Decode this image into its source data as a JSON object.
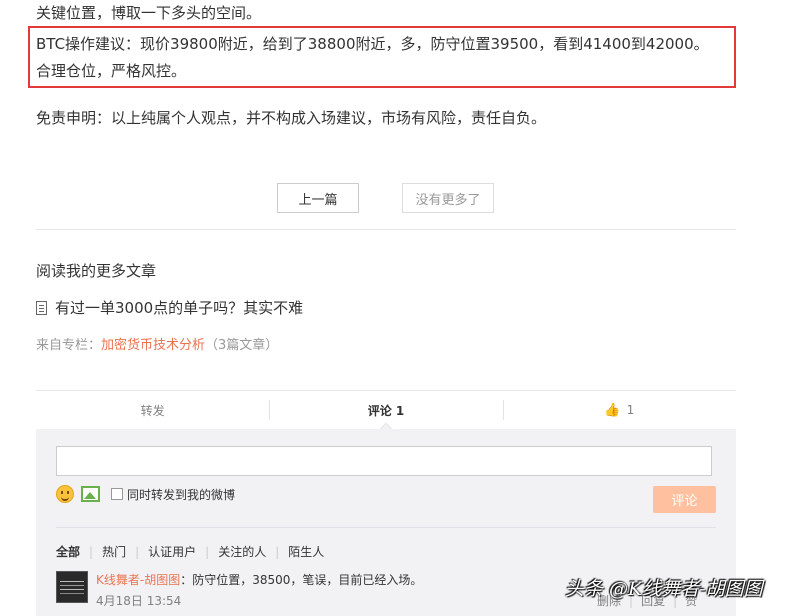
{
  "article": {
    "line1": "关键位置，博取一下多头的空间。",
    "line2": "BTC操作建议：现价39800附近，给到了38800附近，多，防守位置39500，看到41400到42000。",
    "line3": "合理仓位，严格风控。",
    "disclaimer": "免责申明：以上纯属个人观点，并不构成入场建议，市场有风险，责任自负。",
    "highlight_color": "#e23a3a"
  },
  "pager": {
    "prev_label": "上一篇",
    "no_more_label": "没有更多了"
  },
  "more": {
    "title": "阅读我的更多文章",
    "article_title": "有过一单3000点的单子吗？其实不难",
    "from_prefix": "来自专栏：",
    "column_name": "加密货币技术分析",
    "column_count": "（3篇文章）"
  },
  "actions": {
    "repost": "转发",
    "comment": "评论 1",
    "like_count": "1"
  },
  "composer": {
    "repost_checkbox_label": "同时转发到我的微博",
    "submit_label": "评论"
  },
  "filters": [
    "全部",
    "热门",
    "认证用户",
    "关注的人",
    "陌生人"
  ],
  "comment": {
    "author": "K线舞者-胡图图",
    "text": "：防守位置，38500，笔误，目前已经入场。",
    "date": "4月18日 13:54",
    "delete": "删除",
    "reply": "回复",
    "like": "赞"
  },
  "watermark": "头条 @K线舞者-胡图图",
  "colors": {
    "accent": "#eb7350",
    "submit_disabled": "#ffc09f"
  }
}
